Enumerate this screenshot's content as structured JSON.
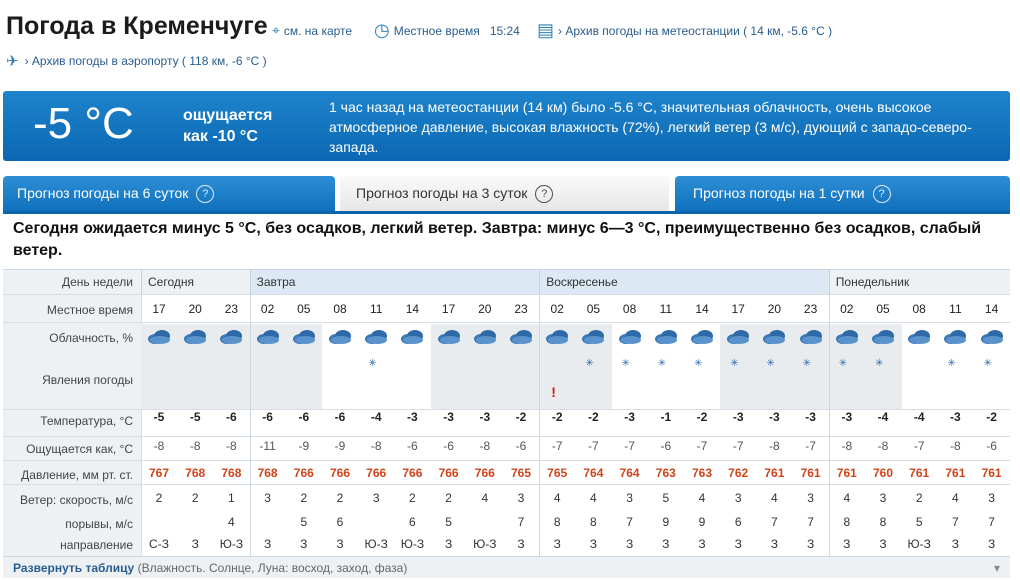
{
  "header": {
    "title": "Погода в Кременчуге",
    "map_link": "см. на карте",
    "local_time_label": "Местное время",
    "local_time": "15:24",
    "archive_station": "› Архив погоды на метеостанции ( 14 км, -5.6 °C )",
    "archive_airport": "› Архив погоды в аэропорту ( 118 км, -6 °C )"
  },
  "current": {
    "temp": "-5 °C",
    "feels_line1": "ощущается",
    "feels_line2": "как -10 °C",
    "description": "1 час назад на метеостанции (14 км) было -5.6 °C, значительная облачность, очень высокое атмосферное давление, высокая влажность (72%), легкий ветер (3 м/с), дующий с западо-северо-запада."
  },
  "tabs": [
    {
      "label": "Прогноз погоды на 6 суток",
      "active": false
    },
    {
      "label": "Прогноз погоды на 3 суток",
      "active": true
    },
    {
      "label": "Прогноз погоды на 1 сутки",
      "active": false
    }
  ],
  "summary": "Сегодня ожидается минус 5 °C, без осадков, легкий ветер. Завтра: минус 6—3 °C, преимущественно без осадков, слабый ветер.",
  "table": {
    "labels": {
      "day": "День недели",
      "time": "Местное время",
      "clouds": "Облачность, %",
      "phenomena": "Явления погоды",
      "temp": "Температура, °C",
      "feels": "Ощущается как, °C",
      "pressure": "Давление, мм рт. ст.",
      "wind_speed": "Ветер: скорость, м/с",
      "gusts": "порывы, м/с",
      "direction": "направление"
    },
    "days": [
      {
        "name": "Сегодня",
        "cols": 3
      },
      {
        "name": "Завтра",
        "cols": 8
      },
      {
        "name": "Воскресенье",
        "cols": 8
      },
      {
        "name": "Понедельник",
        "cols": 5
      }
    ],
    "hours": [
      "17",
      "20",
      "23",
      "02",
      "05",
      "08",
      "11",
      "14",
      "17",
      "20",
      "23",
      "02",
      "05",
      "08",
      "11",
      "14",
      "17",
      "20",
      "23",
      "02",
      "05",
      "08",
      "11",
      "14"
    ],
    "temps": [
      "-5",
      "-5",
      "-6",
      "-6",
      "-6",
      "-6",
      "-4",
      "-3",
      "-3",
      "-3",
      "-2",
      "-2",
      "-2",
      "-3",
      "-1",
      "-2",
      "-3",
      "-3",
      "-3",
      "-3",
      "-4",
      "-4",
      "-3",
      "-2"
    ],
    "feels": [
      "-8",
      "-8",
      "-8",
      "-11",
      "-9",
      "-9",
      "-8",
      "-6",
      "-6",
      "-8",
      "-6",
      "-7",
      "-7",
      "-7",
      "-6",
      "-7",
      "-7",
      "-8",
      "-7",
      "-8",
      "-8",
      "-7",
      "-8",
      "-6"
    ],
    "pressure": [
      "767",
      "768",
      "768",
      "768",
      "766",
      "766",
      "766",
      "766",
      "766",
      "766",
      "765",
      "765",
      "764",
      "764",
      "763",
      "763",
      "762",
      "761",
      "761",
      "761",
      "760",
      "761",
      "761",
      "761"
    ],
    "wind": [
      "2",
      "2",
      "1",
      "3",
      "2",
      "2",
      "3",
      "2",
      "2",
      "4",
      "3",
      "4",
      "4",
      "3",
      "5",
      "4",
      "3",
      "4",
      "3",
      "4",
      "3",
      "2",
      "4",
      "3"
    ],
    "gusts": [
      "",
      "",
      "4",
      "",
      "5",
      "6",
      "",
      "6",
      "5",
      "",
      "7",
      "8",
      "8",
      "7",
      "9",
      "9",
      "6",
      "7",
      "7",
      "8",
      "8",
      "5",
      "7",
      "7"
    ],
    "direction": [
      "С-З",
      "З",
      "Ю-З",
      "З",
      "З",
      "З",
      "Ю-З",
      "Ю-З",
      "З",
      "Ю-З",
      "З",
      "З",
      "З",
      "З",
      "З",
      "З",
      "З",
      "З",
      "З",
      "З",
      "З",
      "Ю-З",
      "З",
      "З"
    ]
  },
  "footer": {
    "expand": "Развернуть таблицу",
    "note": "(Влажность. Солнце, Луна: восход, заход, фаза)"
  }
}
